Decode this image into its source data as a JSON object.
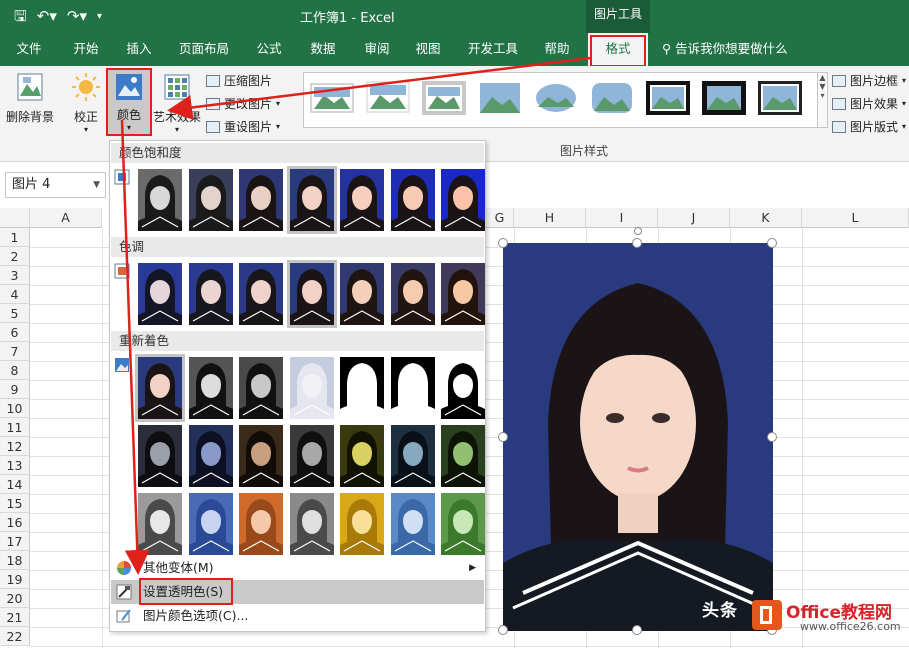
{
  "window": {
    "title": "工作簿1  -  Excel",
    "context_group": "图片工具"
  },
  "tabs": [
    {
      "label": "文件"
    },
    {
      "label": "开始"
    },
    {
      "label": "插入"
    },
    {
      "label": "页面布局"
    },
    {
      "label": "公式"
    },
    {
      "label": "数据"
    },
    {
      "label": "审阅"
    },
    {
      "label": "视图"
    },
    {
      "label": "开发工具"
    },
    {
      "label": "帮助"
    },
    {
      "label": "格式"
    }
  ],
  "tell_me": "告诉我你想要做什么",
  "ribbon": {
    "remove_bg": "删除背景",
    "corrections": "校正",
    "color": "颜色",
    "artistic": "艺术效果",
    "compress": "压缩图片",
    "change": "更改图片",
    "reset": "重设图片",
    "styles_label": "图片样式",
    "border": "图片边框",
    "effects": "图片效果",
    "layout": "图片版式"
  },
  "namebox": "图片 4",
  "columns": [
    "A",
    "G",
    "H",
    "I",
    "J",
    "K",
    "L"
  ],
  "rows": [
    "1",
    "2",
    "3",
    "4",
    "5",
    "6",
    "7",
    "8",
    "9",
    "10",
    "11",
    "12",
    "13",
    "14",
    "15",
    "16",
    "17",
    "18",
    "19",
    "20",
    "21",
    "22"
  ],
  "menu": {
    "saturation": "颜色饱和度",
    "tone": "色调",
    "recolor": "重新着色",
    "more_variants": "其他变体(M)",
    "set_transparent": "设置透明色(S)",
    "color_options": "图片颜色选项(C)..."
  },
  "colors": {
    "excel_green": "#217346",
    "highlight_red": "#e0201a",
    "photo_bg": "#2a3a7e"
  },
  "watermark": {
    "text": "头条",
    "site": "Office教程网",
    "url": "www.office26.com"
  }
}
